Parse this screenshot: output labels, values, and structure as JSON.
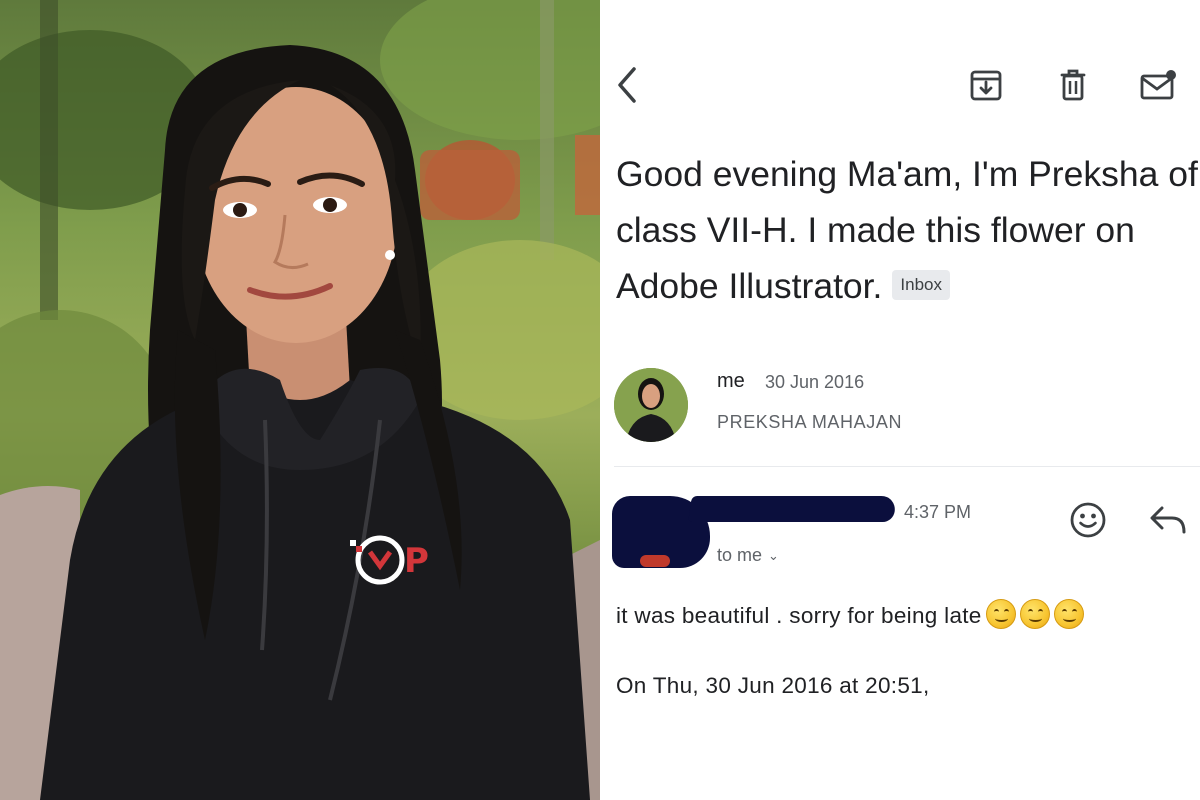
{
  "toolbar": {
    "back_icon": "chevron-left-icon",
    "archive_icon": "archive-icon",
    "delete_icon": "trash-icon",
    "mark_unread_icon": "mail-unread-icon"
  },
  "email": {
    "subject": "Good evening Ma'am, I'm Preksha of class VII-H. I made this flower on Adobe Illustrator.",
    "label_badge": "Inbox",
    "first_message": {
      "sender": "me",
      "date": "30 Jun 2016",
      "sender_line": "PREKSHA MAHAJAN"
    },
    "second_message": {
      "time": "4:37 PM",
      "recipient_line": "to me",
      "body": "it was beautiful . sorry for being late",
      "quoted_header": "On Thu, 30 Jun 2016 at 20:51,"
    }
  },
  "colors": {
    "redaction": "#0b0f3d",
    "text_primary": "#202124",
    "text_secondary": "#5f6368",
    "badge_bg": "#e8eaed"
  }
}
